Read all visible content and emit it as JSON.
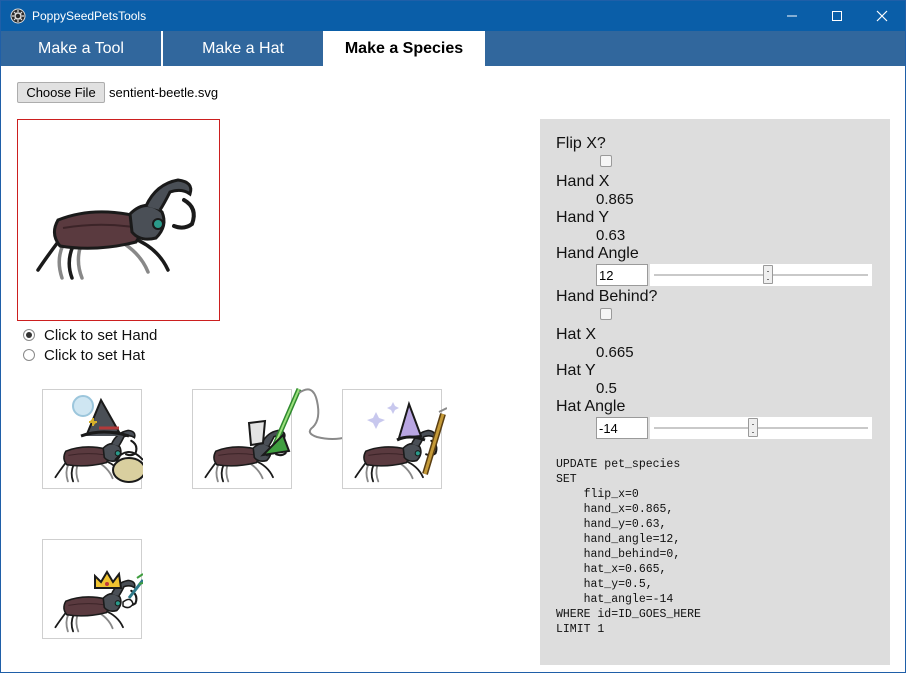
{
  "window": {
    "title": "PoppySeedPetsTools",
    "icon": "gear-icon",
    "controls": [
      "minimize-icon",
      "maximize-icon",
      "close-icon"
    ]
  },
  "tabs": [
    {
      "label": "Make a Tool",
      "active": false
    },
    {
      "label": "Make a Hat",
      "active": false
    },
    {
      "label": "Make a Species",
      "active": true
    }
  ],
  "file": {
    "button_label": "Choose File",
    "file_name": "sentient-beetle.svg"
  },
  "mode_options": [
    {
      "label": "Click to set Hand",
      "checked": true
    },
    {
      "label": "Click to set Hat",
      "checked": false
    }
  ],
  "previews": [
    {
      "name": "witch-hat-basket-preview"
    },
    {
      "name": "bucket-snorkel-preview"
    },
    {
      "name": "unicorn-hat-staff-preview"
    },
    {
      "name": "crown-wand-preview"
    }
  ],
  "settings": {
    "flip_x": {
      "label": "Flip X?",
      "checked": false
    },
    "hand_x": {
      "label": "Hand X",
      "value": "0.865"
    },
    "hand_y": {
      "label": "Hand Y",
      "value": "0.63"
    },
    "hand_angle": {
      "label": "Hand Angle",
      "value": "12",
      "slider_fraction": 0.533
    },
    "hand_behind": {
      "label": "Hand Behind?",
      "checked": false
    },
    "hat_x": {
      "label": "Hat X",
      "value": "0.665"
    },
    "hat_y": {
      "label": "Hat Y",
      "value": "0.5"
    },
    "hat_angle": {
      "label": "Hat Angle",
      "value": "-14",
      "slider_fraction": 0.461
    }
  },
  "sql_lines": [
    "UPDATE pet_species",
    "SET",
    "    flip_x=0",
    "    hand_x=0.865,",
    "    hand_y=0.63,",
    "    hand_angle=12,",
    "    hand_behind=0,",
    "    hat_x=0.665,",
    "    hat_y=0.5,",
    "    hat_angle=-14",
    "WHERE id=ID_GOES_HERE",
    "LIMIT 1"
  ],
  "colors": {
    "titlebar": "#0a5ea8",
    "tabbar": "#31679d",
    "panel": "#dddddd",
    "preview_border": "#cc1f1f",
    "beetle_body": "#5a3a3f"
  }
}
